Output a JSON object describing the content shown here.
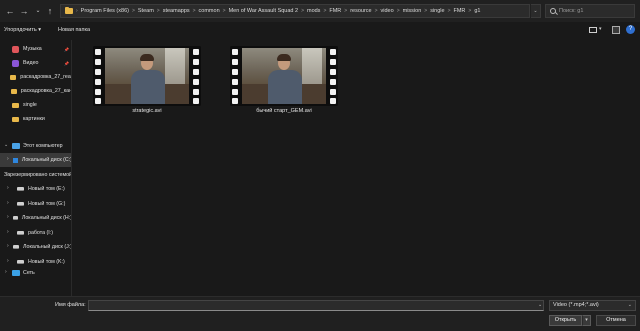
{
  "address": {
    "crumbs": [
      "Program Files (x86)",
      "Steam",
      "steamapps",
      "common",
      "Men of War Assault Squad 2",
      "mods",
      "FMR",
      "resource",
      "video",
      "mission",
      "single",
      "FMR",
      "g1"
    ],
    "separator": ">"
  },
  "search": {
    "placeholder": "Поиск: g1"
  },
  "toolbar": {
    "organize_label": "Упорядочить ▾",
    "new_folder_label": "Новая папка"
  },
  "sidebar": {
    "quick": [
      {
        "label": "Музыка",
        "icon": "music-icon"
      },
      {
        "label": "Видео",
        "icon": "video-icon"
      },
      {
        "label": "раскадровка_27_real",
        "icon": "folder-icon"
      },
      {
        "label": "раскадровка_27_кан",
        "icon": "folder-icon"
      },
      {
        "label": "single",
        "icon": "folder-icon"
      },
      {
        "label": "картинки",
        "icon": "folder-icon"
      }
    ],
    "this_pc": "Этот компьютер",
    "drives": [
      {
        "label": "Локальный диск (C:)",
        "icon": "windows-disk-icon"
      },
      {
        "label": "Зарезервировано системой",
        "icon": "disk-icon"
      },
      {
        "label": "Новый том (E:)",
        "icon": "disk-icon"
      },
      {
        "label": "Новый том (G:)",
        "icon": "disk-icon"
      },
      {
        "label": "Локальный диск (H:)",
        "icon": "disk-icon"
      },
      {
        "label": "работа (I:)",
        "icon": "disk-icon"
      },
      {
        "label": "Локальный диск (J:)",
        "icon": "disk-icon"
      },
      {
        "label": "Новый том (K:)",
        "icon": "disk-icon"
      }
    ],
    "network": "Сеть"
  },
  "files": [
    {
      "name": "strategic.avi",
      "type": "video"
    },
    {
      "name": "бычий старт_GEM.avi",
      "type": "video"
    }
  ],
  "bottom": {
    "filename_label": "Имя файла:",
    "filename_value": "",
    "filetype_value": "Video (*.mp4;*.avi)",
    "open_label": "Открыть",
    "cancel_label": "Отмена"
  },
  "colors": {
    "background": "#191919",
    "folder": "#e8b84a",
    "accent": "#2f6fd0"
  }
}
